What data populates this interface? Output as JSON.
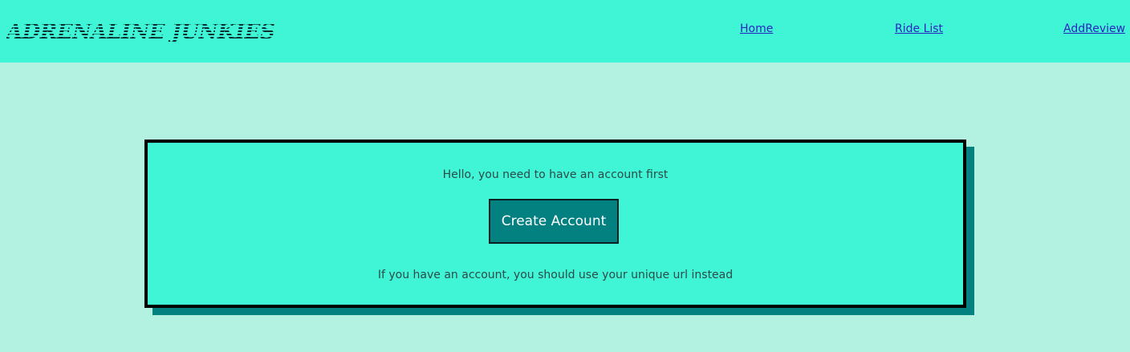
{
  "header": {
    "logo_text": "Adrenaline Junkies",
    "nav": [
      {
        "label": "Home"
      },
      {
        "label": "Ride List"
      },
      {
        "label": "AddReview"
      }
    ]
  },
  "card": {
    "greeting": "Hello, you need to have an account first",
    "create_button_label": "Create Account",
    "hint": "If you have an account, you should use your unique url instead"
  },
  "colors": {
    "page_background": "#b3f1e1",
    "header_background": "#40f5d5",
    "card_background": "#40f5d5",
    "card_shadow": "#038080",
    "button_background": "#038080",
    "link": "#2a25c0"
  }
}
